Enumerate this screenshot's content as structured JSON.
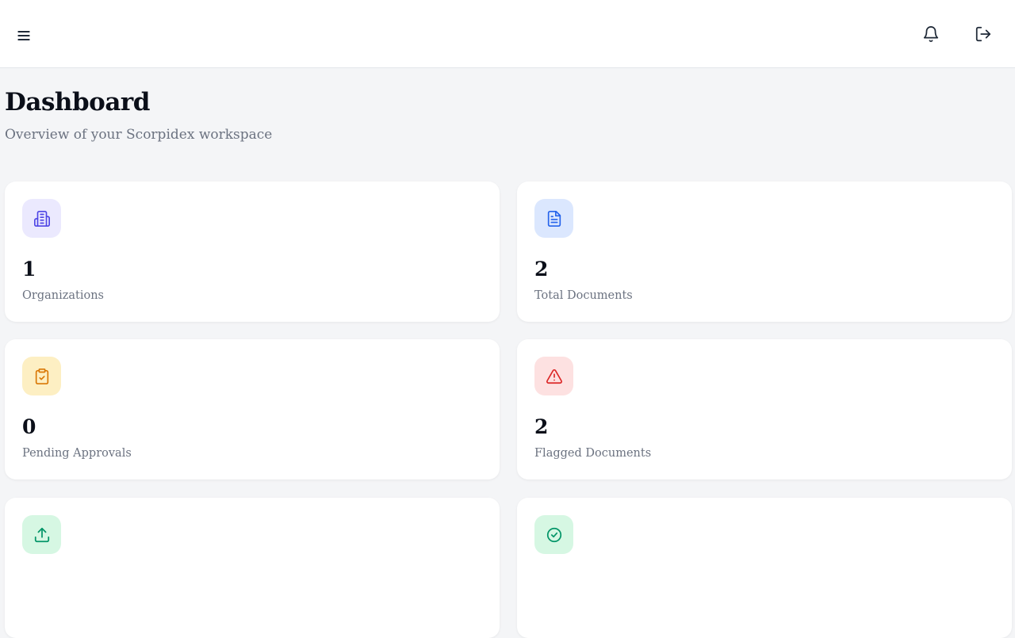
{
  "header": {
    "menu_icon": "hamburger-menu-icon",
    "notification_icon": "bell-icon",
    "logout_icon": "logout-icon"
  },
  "page": {
    "title": "Dashboard",
    "subtitle": "Overview of your Scorpidex workspace"
  },
  "stats": [
    {
      "value": "1",
      "label": "Organizations",
      "icon": "building-icon",
      "icon_bg": "#ebe9fe",
      "icon_color": "#4f46e5"
    },
    {
      "value": "2",
      "label": "Total Documents",
      "icon": "document-icon",
      "icon_bg": "#dbe7fe",
      "icon_color": "#2563eb"
    },
    {
      "value": "0",
      "label": "Pending Approvals",
      "icon": "clipboard-check-icon",
      "icon_bg": "#fdefc3",
      "icon_color": "#d97706"
    },
    {
      "value": "2",
      "label": "Flagged Documents",
      "icon": "alert-triangle-icon",
      "icon_bg": "#fde1e1",
      "icon_color": "#dc2626"
    },
    {
      "value": "",
      "label": "",
      "icon": "upload-icon",
      "icon_bg": "#d6f7e3",
      "icon_color": "#059669"
    },
    {
      "value": "",
      "label": "",
      "icon": "check-circle-icon",
      "icon_bg": "#d6f7e3",
      "icon_color": "#059669"
    }
  ]
}
